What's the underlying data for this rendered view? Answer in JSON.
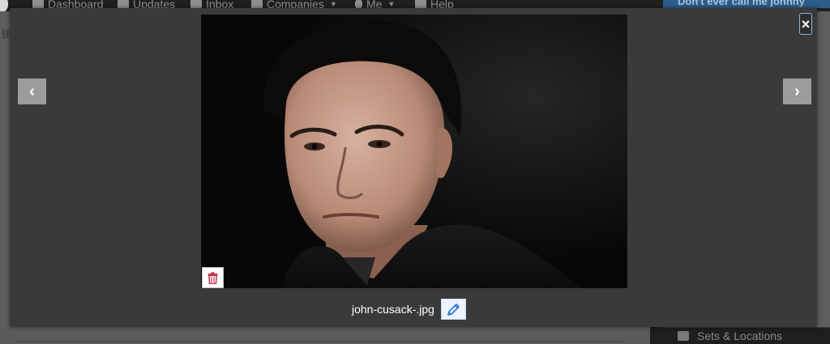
{
  "background_app": {
    "nav": [
      {
        "label": "Dashboard",
        "icon": "dashboard-icon"
      },
      {
        "label": "Updates",
        "icon": "updates-icon"
      },
      {
        "label": "Inbox",
        "icon": "inbox-icon"
      },
      {
        "label": "Companies",
        "icon": "companies-icon"
      },
      {
        "label": "Me",
        "icon": "person-icon"
      },
      {
        "label": "Help",
        "icon": "help-icon"
      }
    ],
    "user_menu_label": "Don't ever call me johnny",
    "sidebar_item": "Sets & Locations"
  },
  "lightbox": {
    "close_label": "×",
    "prev_label": "‹",
    "next_label": "›",
    "filename": "john-cusack-.jpg",
    "icons": {
      "delete": "trash-icon",
      "edit": "pencil-icon",
      "prev": "chevron-left-icon",
      "next": "chevron-right-icon",
      "close": "close-icon"
    },
    "colors": {
      "trash": "#c0304a",
      "edit": "#2f7fd6",
      "overlay": "#3a3a3a"
    }
  }
}
